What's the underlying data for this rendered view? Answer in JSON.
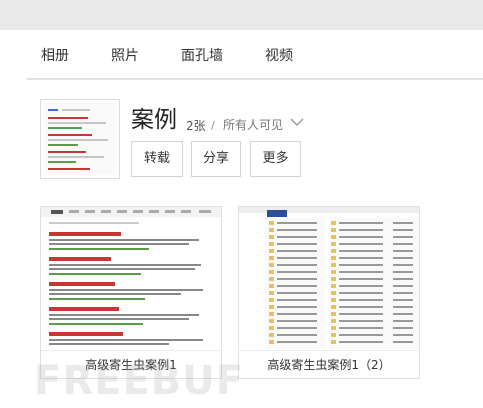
{
  "nav": {
    "tabs": [
      "相册",
      "照片",
      "面孔墙",
      "视频"
    ]
  },
  "album": {
    "title": "案例",
    "count": "2张",
    "separator": "/",
    "visibility": "所有人可见",
    "actions": {
      "repost": "转载",
      "share": "分享",
      "more": "更多"
    }
  },
  "photos": [
    {
      "caption": "高级寄生虫案例1"
    },
    {
      "caption": "高级寄生虫案例1（2）"
    }
  ],
  "watermark": "FREEBUF",
  "colors": {
    "topbar": "#e9e9e9",
    "link_red": "#cc3333",
    "link_blue": "#3f6bd6",
    "url_green": "#5a9c4a",
    "folder": "#e8c25a"
  }
}
